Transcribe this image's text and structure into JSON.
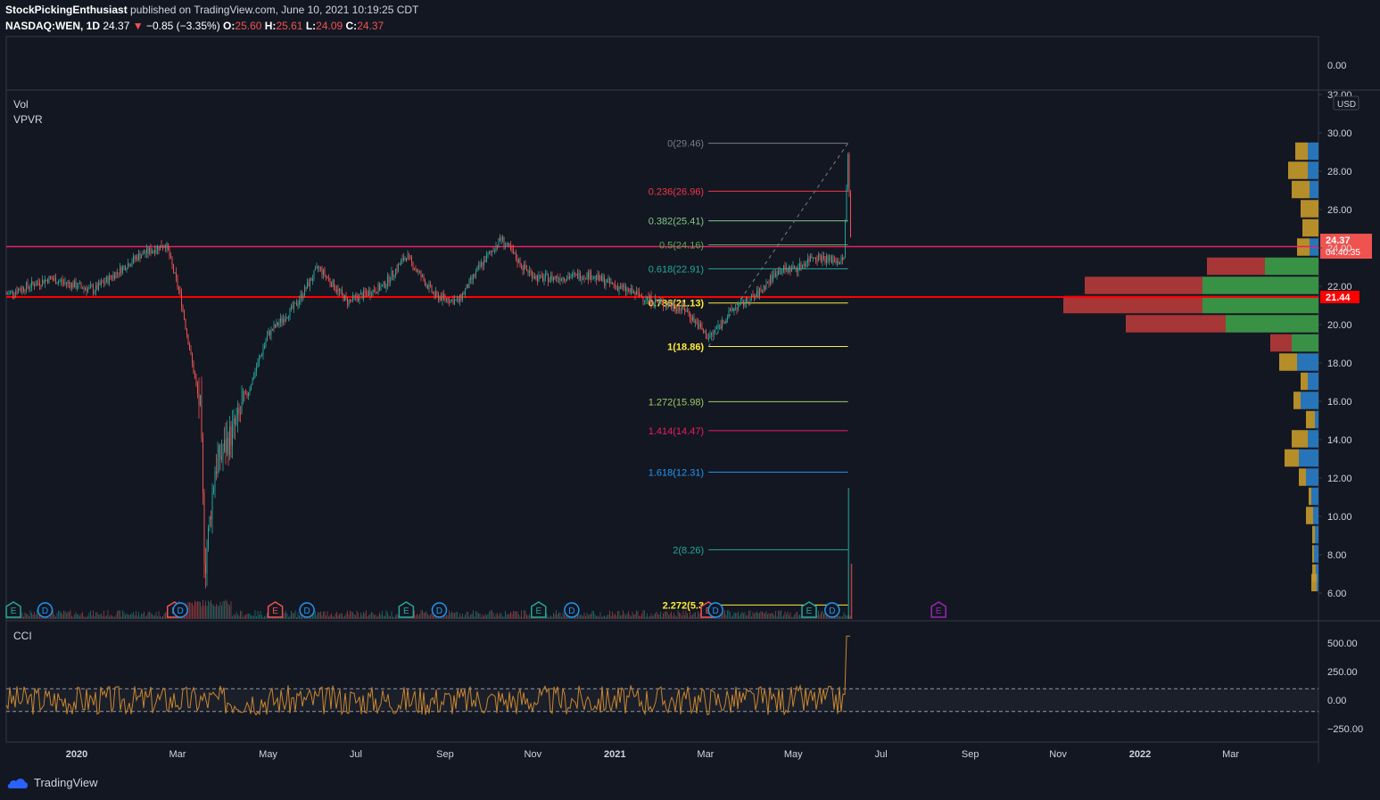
{
  "header": {
    "author": "StockPickingEnthusiast",
    "published_text": "published on TradingView.com, June 10, 2021 10:19:25 CDT",
    "symbol": "NASDAQ:WEN, 1D",
    "last": "24.37",
    "change_arrow": "▼",
    "change": "−0.85 (−3.35%)",
    "o_label": "O:",
    "o": "25.60",
    "h_label": "H:",
    "h": "25.61",
    "l_label": "L:",
    "l": "24.09",
    "c_label": "C:",
    "c": "24.37"
  },
  "footer": {
    "brand": "TradingView"
  },
  "colors": {
    "background": "#131722",
    "up": "#26a69a",
    "down": "#ef5350",
    "magenta_line": "#e91e63",
    "red_line": "#ff0000",
    "cci": "#c8862f",
    "vpvr_up": "#3e9e4a",
    "vpvr_down": "#b83a3a",
    "vpvr_gold": "#c89a2a",
    "vpvr_blue": "#2a7fc9"
  },
  "chart_data": {
    "type": "candlestick",
    "indicators": {
      "vol": "Vol",
      "vpvr": "VPVR",
      "cci": "CCI"
    },
    "price_axis": {
      "currency": "USD",
      "ylim": [
        6,
        32
      ],
      "ticks": [
        "32.00",
        "30.00",
        "28.00",
        "26.00",
        "24.00",
        "22.00",
        "20.00",
        "18.00",
        "16.00",
        "14.00",
        "12.00",
        "10.00",
        "8.00",
        "6.00"
      ],
      "top_pane_tick": "0.00"
    },
    "x_ticks": [
      "2020",
      "Mar",
      "May",
      "Jul",
      "Sep",
      "Nov",
      "2021",
      "Mar",
      "May",
      "Jul",
      "Sep",
      "Nov",
      "2022",
      "Mar"
    ],
    "horizontal_lines": [
      {
        "price": 24.07,
        "color": "#e91e63",
        "label": "24.07"
      },
      {
        "price": 21.44,
        "color": "#ff0000",
        "label": "21.44"
      }
    ],
    "last_price": {
      "value": "24.37",
      "countdown": "04:40:35"
    },
    "fibonacci": [
      {
        "level": "0(29.46)",
        "price": 29.46,
        "color": "#787b86"
      },
      {
        "level": "0.236(26.96)",
        "price": 26.96,
        "color": "#f23645"
      },
      {
        "level": "0.382(25.41)",
        "price": 25.41,
        "color": "#81c784"
      },
      {
        "level": "0.5(24.16)",
        "price": 24.16,
        "color": "#4caf50"
      },
      {
        "level": "0.618(22.91)",
        "price": 22.91,
        "color": "#26a69a"
      },
      {
        "level": "0.786(21.13)",
        "price": 21.13,
        "color": "#ffeb3b"
      },
      {
        "level": "1(18.86)",
        "price": 18.86,
        "color": "#ffeb3b"
      },
      {
        "level": "1.272(15.98)",
        "price": 15.98,
        "color": "#9ccc65"
      },
      {
        "level": "1.414(14.47)",
        "price": 14.47,
        "color": "#e91e63"
      },
      {
        "level": "1.618(12.31)",
        "price": 12.31,
        "color": "#2196f3"
      },
      {
        "level": "2(8.26)",
        "price": 8.26,
        "color": "#26a69a"
      },
      {
        "level": "2.272(5.3",
        "price": 5.38,
        "color": "#ffeb3b"
      }
    ],
    "price_path": [
      [
        "2019-11",
        21.6
      ],
      [
        "2019-12",
        22.4
      ],
      [
        "2020-01",
        21.8
      ],
      [
        "2020-02",
        23.6
      ],
      [
        "2020-02-20",
        24.2
      ],
      [
        "2020-03-01",
        21.5
      ],
      [
        "2020-03-15",
        15.5
      ],
      [
        "2020-03-18",
        7.2
      ],
      [
        "2020-03-25",
        12.5
      ],
      [
        "2020-04-10",
        15.0
      ],
      [
        "2020-05-01",
        19.5
      ],
      [
        "2020-05-20",
        21.0
      ],
      [
        "2020-06-05",
        23.0
      ],
      [
        "2020-06-25",
        21.2
      ],
      [
        "2020-07-20",
        22.0
      ],
      [
        "2020-08-05",
        23.6
      ],
      [
        "2020-08-25",
        21.5
      ],
      [
        "2020-09-10",
        21.2
      ],
      [
        "2020-09-25",
        23.0
      ],
      [
        "2020-10-10",
        24.5
      ],
      [
        "2020-10-25",
        23.0
      ],
      [
        "2020-11-05",
        22.4
      ],
      [
        "2020-11-25",
        22.5
      ],
      [
        "2020-12-10",
        22.6
      ],
      [
        "2021-01-05",
        21.8
      ],
      [
        "2021-01-25",
        21.2
      ],
      [
        "2021-02-15",
        20.8
      ],
      [
        "2021-03-03",
        19.3
      ],
      [
        "2021-03-20",
        20.8
      ],
      [
        "2021-04-05",
        21.5
      ],
      [
        "2021-04-20",
        22.8
      ],
      [
        "2021-05-05",
        23.0
      ],
      [
        "2021-05-15",
        23.6
      ],
      [
        "2021-05-25",
        23.4
      ],
      [
        "2021-06-05",
        23.3
      ],
      [
        "2021-06-08",
        28.9
      ],
      [
        "2021-06-10",
        24.37
      ]
    ],
    "cci": {
      "ticks": [
        "500.00",
        "250.00",
        "0.00",
        "−250.00"
      ],
      "bands": [
        100,
        -100
      ],
      "spike": 560
    },
    "vpvr_rows": [
      {
        "price": 29.0,
        "up": 0,
        "down": 0,
        "gold": 14,
        "blue": 12
      },
      {
        "price": 28.0,
        "up": 0,
        "down": 0,
        "gold": 22,
        "blue": 12
      },
      {
        "price": 27.0,
        "up": 0,
        "down": 0,
        "gold": 20,
        "blue": 10
      },
      {
        "price": 26.0,
        "up": 0,
        "down": 0,
        "gold": 20,
        "blue": 0
      },
      {
        "price": 25.0,
        "up": 0,
        "down": 0,
        "gold": 18,
        "blue": 0
      },
      {
        "price": 24.0,
        "up": 0,
        "down": 0,
        "gold": 14,
        "blue": 10
      },
      {
        "price": 23.0,
        "up": 60,
        "down": 65,
        "gold": 0,
        "blue": 0
      },
      {
        "price": 22.0,
        "up": 130,
        "down": 132,
        "gold": 0,
        "blue": 0
      },
      {
        "price": 21.0,
        "up": 130,
        "down": 156,
        "gold": 0,
        "blue": 0
      },
      {
        "price": 20.0,
        "up": 104,
        "down": 112,
        "gold": 0,
        "blue": 0
      },
      {
        "price": 19.0,
        "up": 30,
        "down": 24,
        "gold": 0,
        "blue": 0
      },
      {
        "price": 18.0,
        "up": 0,
        "down": 0,
        "gold": 20,
        "blue": 24
      },
      {
        "price": 17.0,
        "up": 0,
        "down": 0,
        "gold": 8,
        "blue": 12
      },
      {
        "price": 16.0,
        "up": 0,
        "down": 0,
        "gold": 8,
        "blue": 20
      },
      {
        "price": 15.0,
        "up": 0,
        "down": 0,
        "gold": 10,
        "blue": 4
      },
      {
        "price": 14.0,
        "up": 0,
        "down": 0,
        "gold": 18,
        "blue": 12
      },
      {
        "price": 13.0,
        "up": 0,
        "down": 0,
        "gold": 16,
        "blue": 22
      },
      {
        "price": 12.0,
        "up": 0,
        "down": 0,
        "gold": 8,
        "blue": 14
      },
      {
        "price": 11.0,
        "up": 0,
        "down": 0,
        "gold": 3,
        "blue": 8
      },
      {
        "price": 10.0,
        "up": 0,
        "down": 0,
        "gold": 8,
        "blue": 6
      },
      {
        "price": 9.0,
        "up": 0,
        "down": 0,
        "gold": 3,
        "blue": 4
      },
      {
        "price": 8.0,
        "up": 0,
        "down": 0,
        "gold": 2,
        "blue": 5
      },
      {
        "price": 7.0,
        "up": 0,
        "down": 0,
        "gold": 4,
        "blue": 3
      },
      {
        "price": 6.5,
        "up": 0,
        "down": 0,
        "gold": 6,
        "blue": 2
      }
    ],
    "events": [
      {
        "type": "E",
        "date": "2019-11-06",
        "color": "#26a69a"
      },
      {
        "type": "D",
        "date": "2019-11-28",
        "color": "#2196f3"
      },
      {
        "type": "E",
        "date": "2020-02-26",
        "color": "#ef5350"
      },
      {
        "type": "D",
        "date": "2020-03-01",
        "color": "#2196f3"
      },
      {
        "type": "E",
        "date": "2020-05-06",
        "color": "#ef5350"
      },
      {
        "type": "D",
        "date": "2020-05-28",
        "color": "#2196f3"
      },
      {
        "type": "E",
        "date": "2020-08-05",
        "color": "#26a69a"
      },
      {
        "type": "D",
        "date": "2020-08-28",
        "color": "#2196f3"
      },
      {
        "type": "E",
        "date": "2020-11-05",
        "color": "#26a69a"
      },
      {
        "type": "D",
        "date": "2020-11-28",
        "color": "#2196f3"
      },
      {
        "type": "E",
        "date": "2021-03-03",
        "color": "#ef5350"
      },
      {
        "type": "D",
        "date": "2021-03-08",
        "color": "#2196f3"
      },
      {
        "type": "E",
        "date": "2021-05-12",
        "color": "#26a69a"
      },
      {
        "type": "D",
        "date": "2021-05-28",
        "color": "#2196f3"
      },
      {
        "type": "E",
        "date": "2021-08-10",
        "color": "#9c27b0"
      }
    ]
  }
}
